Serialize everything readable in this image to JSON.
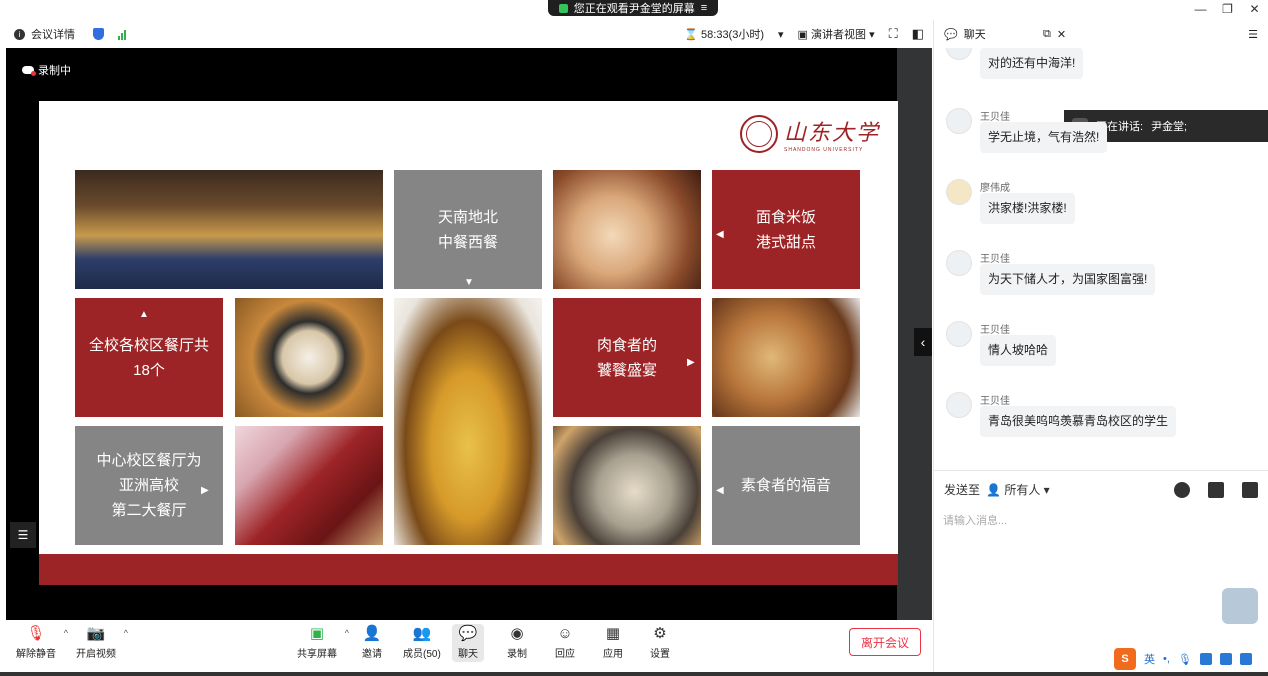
{
  "top_notice": "您正在观看尹金堂的屏幕",
  "window_controls": [
    "—",
    "❐",
    "✕"
  ],
  "meeting_bar": {
    "details_label": "会议详情",
    "timer": "58:33(3小时)",
    "view_label": "演讲者视图"
  },
  "stage": {
    "recording_label": "录制中",
    "slide": {
      "logo_cn": "山东大学",
      "logo_en": "SHANDONG UNIVERSITY",
      "tiles": {
        "t1": "天南地北\n中餐西餐",
        "t2": "面食米饭\n港式甜点",
        "t3": "全校各校区餐厅共\n18个",
        "t4": "肉食者的\n饕餮盛宴",
        "t5": "中心校区餐厅为\n亚洲高校\n第二大餐厅",
        "t6": "素食者的福音"
      }
    }
  },
  "speaking": {
    "label": "正在讲话:",
    "name": "尹金堂;"
  },
  "chat": {
    "title": "聊天",
    "messages": [
      {
        "sender": "",
        "text": "对的还有中海洋!"
      },
      {
        "sender": "王贝佳",
        "text": "学无止境，气有浩然!"
      },
      {
        "sender": "廖伟成",
        "text": "洪家楼!洪家楼!"
      },
      {
        "sender": "王贝佳",
        "text": "为天下储人才，为国家图富强!"
      },
      {
        "sender": "王贝佳",
        "text": "情人坡哈哈"
      },
      {
        "sender": "王贝佳",
        "text": "青岛很美呜呜羡慕青岛校区的学生"
      }
    ],
    "send_to_label": "发送至",
    "recipient": "所有人",
    "input_placeholder": "请输入消息..."
  },
  "controls": {
    "unmute": "解除静音",
    "start_video": "开启视频",
    "share_screen": "共享屏幕",
    "invite": "邀请",
    "members": "成员(50)",
    "chat": "聊天",
    "record": "录制",
    "reactions": "回应",
    "apps": "应用",
    "settings": "设置",
    "leave": "离开会议"
  },
  "ime": {
    "lang": "英"
  },
  "colors": {
    "accent_red": "#9d2426",
    "tile_gray": "#858585",
    "leave_red": "#e33344"
  }
}
